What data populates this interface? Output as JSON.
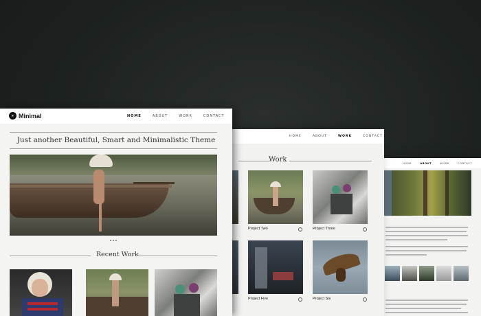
{
  "front": {
    "logo_text": "Minimal",
    "nav": [
      "Home",
      "About",
      "Work",
      "Contact"
    ],
    "nav_active": "Home",
    "tagline": "Just another Beautiful, Smart and Minimalistic Theme",
    "recent_work_title": "Recent Work"
  },
  "middle": {
    "nav": [
      "Home",
      "About",
      "Work",
      "Contact"
    ],
    "nav_active": "Work",
    "section_title": "Work",
    "projects": [
      "Project Two",
      "Project Three",
      "Project Five",
      "Project Six"
    ]
  },
  "back": {
    "nav": [
      "Home",
      "About",
      "Work",
      "Contact"
    ],
    "nav_active": "About"
  },
  "colors": {
    "background": "#1d2220",
    "page": "#f4f4f3",
    "text": "#333333"
  },
  "icons": [
    "eye-logo-icon",
    "gear-icon"
  ]
}
